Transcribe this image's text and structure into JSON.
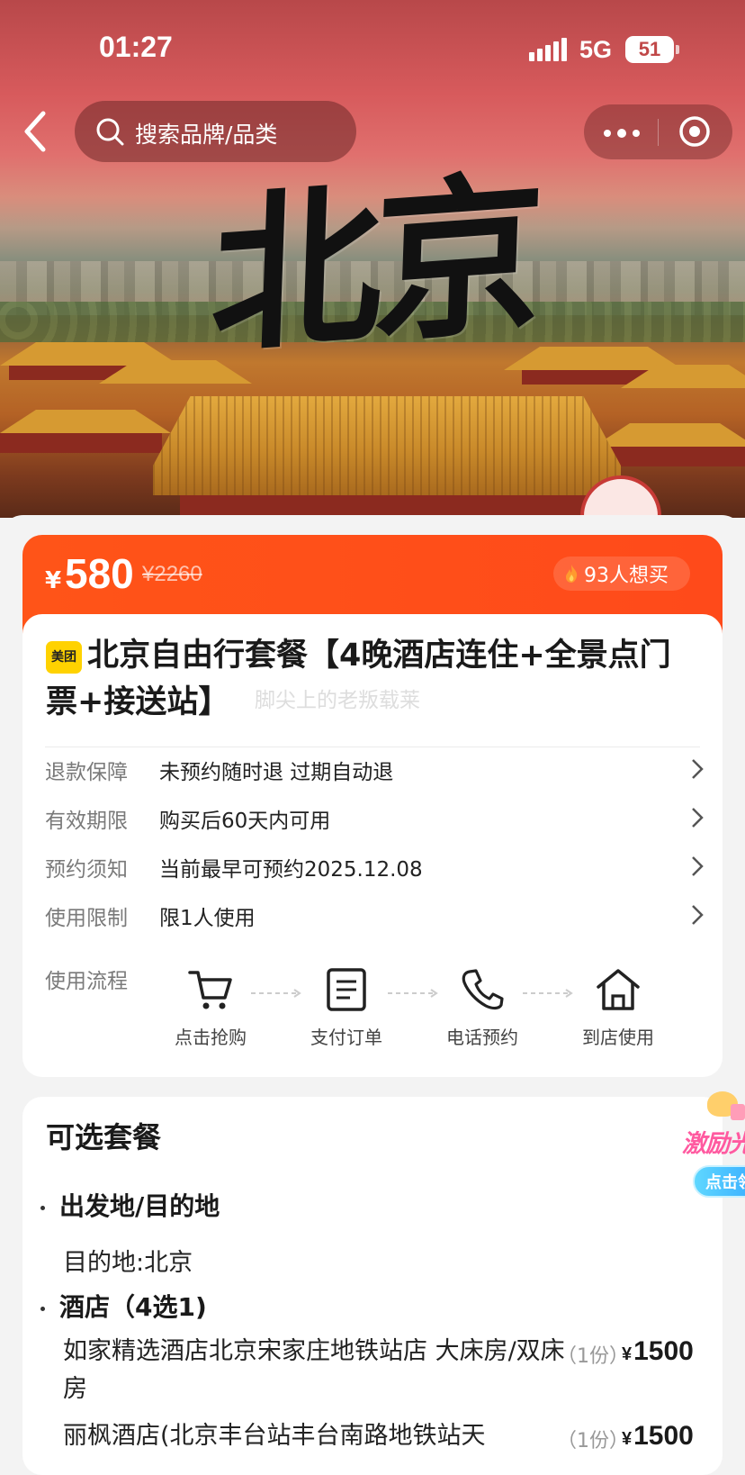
{
  "status_bar": {
    "time": "01:27",
    "network": "5G",
    "battery": "51"
  },
  "nav": {
    "search_placeholder": "搜索品牌/品类",
    "back_icon": "chevron-left-icon",
    "more_icon": "more-dots-icon",
    "close_icon": "target-circle-icon"
  },
  "hero": {
    "title_art": "北京"
  },
  "price_bar": {
    "currency": "¥",
    "price": "580",
    "original_price": "¥2260",
    "want_count": "93人想买",
    "accent_color": "#ff5418"
  },
  "product": {
    "brand_badge": "美团",
    "title": "北京自由行套餐【4晚酒店连住+全景点门票+接送站】",
    "watermark": "脚尖上的老叛载莱"
  },
  "info_rows": [
    {
      "label": "退款保障",
      "value": "未预约随时退 过期自动退"
    },
    {
      "label": "有效期限",
      "value": "购买后60天内可用"
    },
    {
      "label": "预约须知",
      "value": "当前最早可预约2025.12.08"
    },
    {
      "label": "使用限制",
      "value": "限1人使用"
    }
  ],
  "process": {
    "label": "使用流程",
    "steps": [
      {
        "icon": "cart-icon",
        "label": "点击抢购"
      },
      {
        "icon": "document-icon",
        "label": "支付订单"
      },
      {
        "icon": "phone-icon",
        "label": "电话预约"
      },
      {
        "icon": "home-icon",
        "label": "到店使用"
      }
    ]
  },
  "packages": {
    "title": "可选套餐",
    "sections": [
      {
        "heading": "出发地/目的地",
        "text": "目的地:北京"
      },
      {
        "heading": "酒店（4选1)"
      }
    ],
    "hotels": [
      {
        "name": "如家精选酒店北京宋家庄地铁站店 大床房/双床房",
        "qty": "（1份）",
        "currency": "¥",
        "price": "1500"
      },
      {
        "name": "丽枫酒店(北京丰台站丰台南路地铁站天",
        "qty": "（1份）",
        "currency": "¥",
        "price": "1500"
      }
    ]
  },
  "promo": {
    "text": "激励光",
    "button": "点击领"
  }
}
